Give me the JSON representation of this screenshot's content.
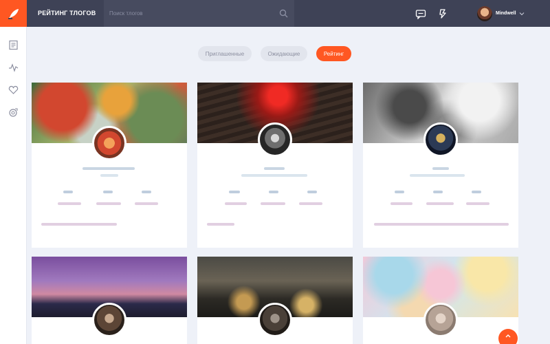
{
  "header": {
    "title": "РЕЙТИНГ ТЛОГОВ",
    "search_placeholder": "Поиск тлогов",
    "username": "Mindwell"
  },
  "tabs": [
    {
      "label": "Приглашенные",
      "active": false
    },
    {
      "label": "Ожидающие",
      "active": false
    },
    {
      "label": "Рейтинг",
      "active": true
    }
  ],
  "sidebar": {
    "items": [
      {
        "icon": "feed-icon"
      },
      {
        "icon": "activity-icon"
      },
      {
        "icon": "heart-icon"
      },
      {
        "icon": "discover-icon"
      }
    ]
  },
  "colors": {
    "accent": "#ff5722",
    "topbar": "#3e4256",
    "search_bg": "#474b5f",
    "page_bg": "#eef1f8"
  },
  "cards": [
    {
      "cover": "flowers-garden"
    },
    {
      "cover": "dark-red-glow"
    },
    {
      "cover": "grey-monochrome"
    },
    {
      "cover": "purple-sunset-hills"
    },
    {
      "cover": "dark-city-lights"
    },
    {
      "cover": "pastel-clouds"
    }
  ]
}
